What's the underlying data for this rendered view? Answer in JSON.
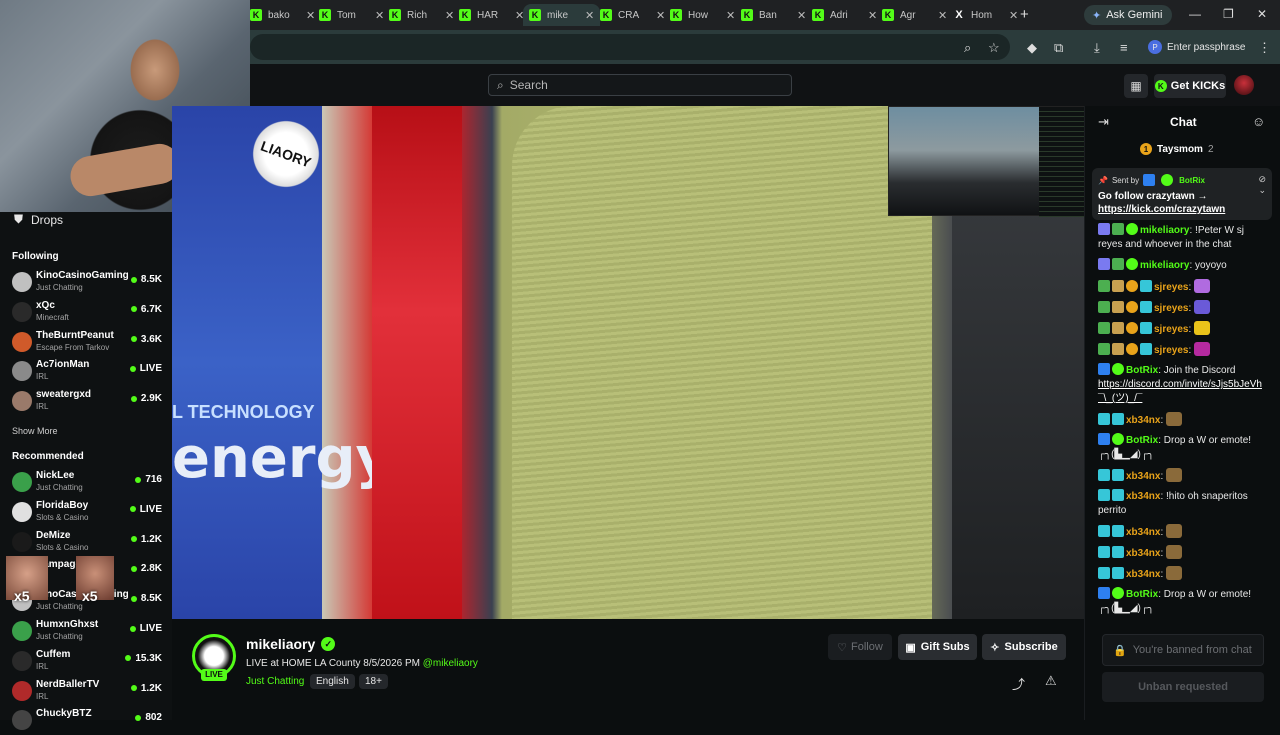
{
  "browser": {
    "tabs": [
      {
        "title": "bako"
      },
      {
        "title": "Tom"
      },
      {
        "title": "Rich"
      },
      {
        "title": "HAR"
      },
      {
        "title": "mike"
      },
      {
        "title": "CRA"
      },
      {
        "title": "How"
      },
      {
        "title": "Ban"
      },
      {
        "title": "Adri"
      },
      {
        "title": "Agr"
      },
      {
        "title": "Hom"
      }
    ],
    "gemini_label": "Ask Gemini",
    "passphrase_label": "Enter passphrase"
  },
  "header": {
    "search_placeholder": "Search",
    "get_kicks_label": "Get KICKs"
  },
  "sidebar": {
    "drops_label": "Drops",
    "following_heading": "Following",
    "following": [
      {
        "name": "KinoCasinoGaming",
        "category": "Just Chatting",
        "viewers": "8.5K",
        "color": "#c0c0c0"
      },
      {
        "name": "xQc",
        "category": "Minecraft",
        "viewers": "6.7K",
        "color": "#2a2a2a"
      },
      {
        "name": "TheBurntPeanut",
        "category": "Escape From Tarkov",
        "viewers": "3.6K",
        "color": "#d05a2a"
      },
      {
        "name": "Ac7ionMan",
        "category": "IRL",
        "viewers": "LIVE",
        "color": "#8a8a8a"
      },
      {
        "name": "sweatergxd",
        "category": "IRL",
        "viewers": "2.9K",
        "color": "#9a7a6a"
      }
    ],
    "show_more_label": "Show More",
    "recommended_heading": "Recommended",
    "recommended": [
      {
        "name": "NickLee",
        "category": "Just Chatting",
        "viewers": "716",
        "color": "#3aa04a"
      },
      {
        "name": "FloridaBoy",
        "category": "Slots & Casino",
        "viewers": "LIVE",
        "color": "#e0e0e0"
      },
      {
        "name": "DeMize",
        "category": "Slots & Casino",
        "viewers": "1.2K",
        "color": "#1a1a1a"
      },
      {
        "name": "Rampage",
        "category": "",
        "viewers": "2.8K",
        "color": "#c06040"
      },
      {
        "name": "KinoCasinoGaming",
        "category": "Just Chatting",
        "viewers": "8.5K",
        "color": "#c0c0c0"
      },
      {
        "name": "HumxnGhxst",
        "category": "Just Chatting",
        "viewers": "LIVE",
        "color": "#3aa04a"
      },
      {
        "name": "Cuffem",
        "category": "IRL",
        "viewers": "15.3K",
        "color": "#2a2a2a"
      },
      {
        "name": "NerdBallerTV",
        "category": "IRL",
        "viewers": "1.2K",
        "color": "#b02a2a"
      },
      {
        "name": "ChuckyBTZ",
        "category": "",
        "viewers": "802",
        "color": "#444"
      }
    ],
    "emote_multiplier_1": "x5",
    "emote_multiplier_2": "x5"
  },
  "video": {
    "overlay_text": "energy",
    "overlay_tech": "L TECHNOLOGY",
    "sticker_text": "LIAORY"
  },
  "stream": {
    "channel": "mikeliaory",
    "live_badge": "LIVE",
    "title": "LIVE at HOME LA County 8/5/2026 PM",
    "title_mention": "@mikeliaory",
    "category": "Just Chatting",
    "tags": [
      "English",
      "18+"
    ],
    "follow_label": "Follow",
    "gift_label": "Gift Subs",
    "subscribe_label": "Subscribe"
  },
  "chat": {
    "title": "Chat",
    "top_gifter": {
      "name": "Taysmom",
      "count": "2"
    },
    "pinned": {
      "sent_by_label": "Sent by",
      "sender": "BotRix",
      "message": "Go follow crazytawn →",
      "link": "https://kick.com/crazytawn"
    },
    "messages": [
      {
        "user": "mikeliaory",
        "color": "#53fc18",
        "text": "!Peter W sj reyes and whoever in the chat"
      },
      {
        "user": "mikeliaory",
        "color": "#53fc18",
        "text": "yoyoyo"
      },
      {
        "user": "sjreyes",
        "color": "#e9a31a",
        "text": ""
      },
      {
        "user": "sjreyes",
        "color": "#e9a31a",
        "text": ""
      },
      {
        "user": "sjreyes",
        "color": "#e9a31a",
        "text": ""
      },
      {
        "user": "sjreyes",
        "color": "#e9a31a",
        "text": ""
      },
      {
        "user": "BotRix",
        "color": "#53fc18",
        "text": "Join the Discord",
        "link": "https://discord.com/invite/sJjs5bJeVh ¯\\_(ツ)_/¯"
      },
      {
        "user": "xb34nx",
        "color": "#e9a31a",
        "text": ""
      },
      {
        "user": "BotRix",
        "color": "#53fc18",
        "text": "Drop a W or emote! ┌╮(▙▁◢)┌╮"
      },
      {
        "user": "xb34nx",
        "color": "#e9a31a",
        "text": ""
      },
      {
        "user": "xb34nx",
        "color": "#e9a31a",
        "text": "!hito oh snaperitos perrito"
      },
      {
        "user": "xb34nx",
        "color": "#e9a31a",
        "text": ""
      },
      {
        "user": "xb34nx",
        "color": "#e9a31a",
        "text": ""
      },
      {
        "user": "xb34nx",
        "color": "#e9a31a",
        "text": ""
      },
      {
        "user": "BotRix",
        "color": "#53fc18",
        "text": "Drop a W or emote! ┌╮(▙▁◢)┌╮"
      }
    ],
    "banned_placeholder": "You're banned from chat",
    "unban_label": "Unban requested"
  }
}
